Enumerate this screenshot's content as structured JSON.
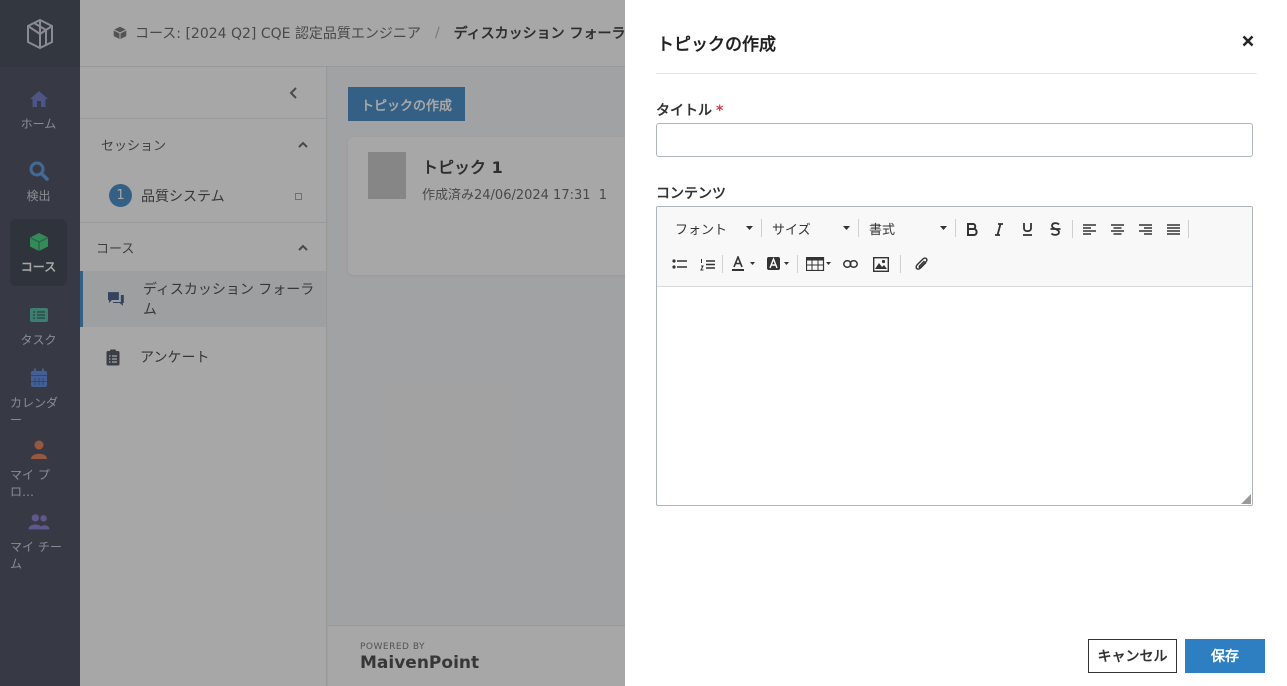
{
  "rail": {
    "items": [
      {
        "label": "ホーム",
        "icon": "home-icon",
        "color": "#5c6bc0"
      },
      {
        "label": "検出",
        "icon": "search-icon",
        "color": "#4a90e2"
      },
      {
        "label": "コース",
        "icon": "cube-icon",
        "color": "#2ecc71"
      },
      {
        "label": "タスク",
        "icon": "task-list-icon",
        "color": "#3fb59b"
      },
      {
        "label": "カレンダー",
        "icon": "calendar-icon",
        "color": "#4a7fe0"
      },
      {
        "label": "マイ プロ…",
        "icon": "person-icon",
        "color": "#e07040"
      },
      {
        "label": "マイ チーム",
        "icon": "team-icon",
        "color": "#7a6fd0"
      }
    ]
  },
  "breadcrumb": {
    "course": "コース: [2024 Q2] CQE 認定品質エンジニア",
    "separator": "/",
    "current": "ディスカッション フォーラム"
  },
  "sidebar": {
    "session_header": "セッション",
    "session_item_number": "1",
    "session_item_label": "品質システム",
    "course_header": "コース",
    "items": [
      {
        "label": "ディスカッション フォーラム",
        "icon": "chat-bubbles-icon"
      },
      {
        "label": "アンケート",
        "icon": "clipboard-icon"
      }
    ]
  },
  "content": {
    "create_button": "トピックの作成",
    "topic_title": "トピック 1",
    "topic_meta": "作成済み24/06/2024 17:31  1",
    "footer_powered": "POWERED BY",
    "footer_brand": "MaivenPoint"
  },
  "dialog": {
    "title": "トピックの作成",
    "title_label": "タイトル",
    "required_mark": "*",
    "title_value": "",
    "content_label": "コンテンツ",
    "font_select": "フォント",
    "size_select": "サイズ",
    "format_select": "書式",
    "cancel_label": "キャンセル",
    "save_label": "保存"
  },
  "colors": {
    "primary": "#2e7fc1",
    "required": "#d9363e",
    "rail_bg": "#333a4d"
  }
}
